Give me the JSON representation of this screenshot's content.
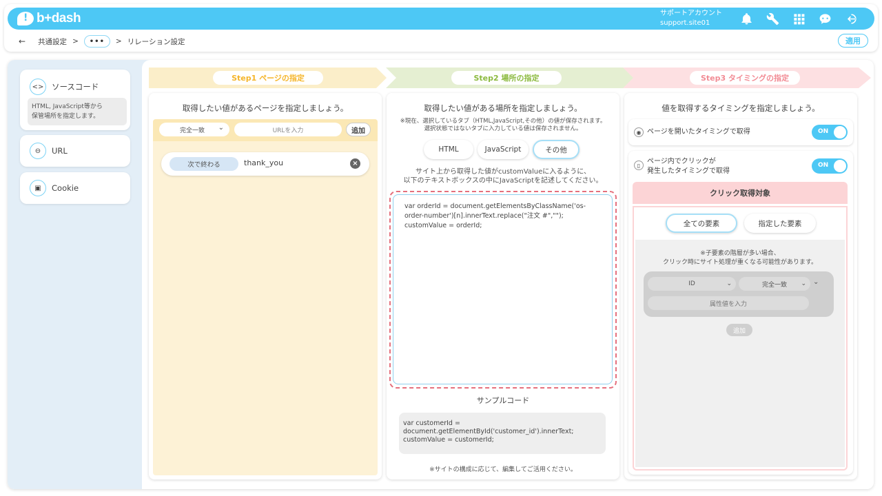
{
  "header": {
    "logo": "b+dash",
    "account_title": "サポートアカウント",
    "account_site": "support.site01",
    "breadcrumb": {
      "back": "←",
      "item1": "共通設定",
      "sep1": ">",
      "more": "•••",
      "sep2": ">",
      "current": "リレーション設定"
    },
    "apply_label": "適用",
    "icons": [
      "bell-icon",
      "wrench-icon",
      "grid-icon",
      "chat-icon",
      "logout-icon"
    ]
  },
  "sidebar": {
    "items": [
      {
        "icon": "<>",
        "label": "ソースコード",
        "desc_line1": "HTML, JavaScript等から",
        "desc_line2": "保管場所を指定します。"
      },
      {
        "icon": "⊖",
        "label": "URL"
      },
      {
        "icon": "▣",
        "label": "Cookie"
      }
    ]
  },
  "steps": [
    {
      "label": "Step1 ページの指定",
      "color": "#f5b52a"
    },
    {
      "label": "Step2 場所の指定",
      "color": "#8cba3f"
    },
    {
      "label": "Step3 タイミングの指定",
      "color": "#f28b94"
    }
  ],
  "panel1": {
    "title": "取得したい値があるページを指定しましょう。",
    "match_select": "完全一致",
    "url_placeholder": "URLを入力",
    "add_label": "追加",
    "rule": {
      "type": "次で終わる",
      "value": "thank_you",
      "remove": "×"
    }
  },
  "panel2": {
    "title": "取得したい値がある場所を指定しましょう。",
    "note_line1": "※現在、選択しているタブ（HTML,JavaScript,その他）の値が保存されます。",
    "note_line2": "選択状態ではないタブに入力している値は保存されません。",
    "tabs": [
      "HTML",
      "JavaScript",
      "その他"
    ],
    "instruction_line1": "サイト上から取得した値がcustomValueに入るように、",
    "instruction_line2": "以下のテキストボックスの中にJavaScriptを記述してください。",
    "code": "var orderId = document.getElementsByClassName('os-order-number')[n].innerText.replace(\"注文 #\",\"\");\ncustomValue = orderId;",
    "sample_title": "サンプルコード",
    "sample_code": "var customerId =\ndocument.getElementById('customer_id').innerText;\ncustomValue = customerId;",
    "footer_note": "※サイトの構成に応じて、編集してご活用ください。"
  },
  "panel3": {
    "title": "値を取得するタイミングを指定しましょう。",
    "trigger1": {
      "label": "ページを開いたタイミングで取得",
      "toggle": "ON"
    },
    "trigger2": {
      "label_line1": "ページ内でクリックが",
      "label_line2": "発生したタイミングで取得",
      "toggle": "ON"
    },
    "click_target_title": "クリック取得対象",
    "click_tabs": [
      "全ての要素",
      "指定した要素"
    ],
    "note_line1": "※子要素の階層が多い場合、",
    "note_line2": "クリック時にサイト処理が重くなる可能性があります。",
    "attr_select": "ID",
    "match_select": "完全一致",
    "attr_placeholder": "属性値を入力",
    "add_label": "追加"
  }
}
